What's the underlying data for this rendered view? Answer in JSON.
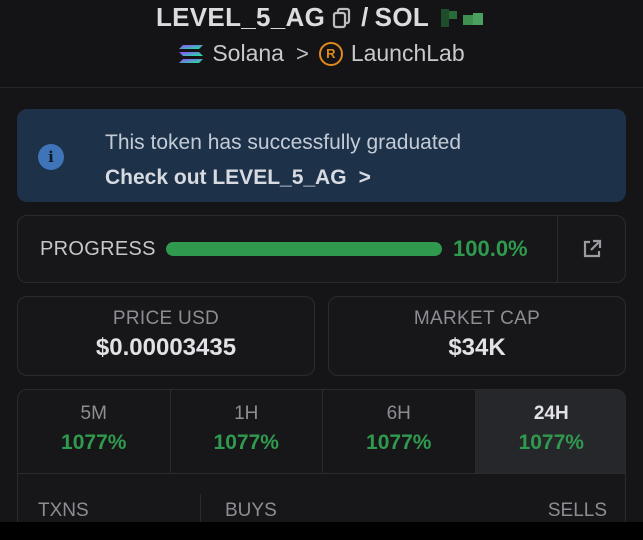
{
  "header": {
    "token": "LEVEL_5_AG",
    "separator": "/",
    "quote": "SOL",
    "chain": "Solana",
    "chevron": ">",
    "launchpad": "LaunchLab",
    "launchpad_icon_letter": "R"
  },
  "banner": {
    "message": "This token has successfully graduated",
    "cta": "Check out LEVEL_5_AG",
    "cta_arrow": ">",
    "icon_glyph": "i"
  },
  "progress": {
    "label": "PROGRESS",
    "value": "100.0%",
    "fraction": 1.0
  },
  "stats": {
    "price_label": "PRICE USD",
    "price_value": "$0.00003435",
    "mcap_label": "MARKET CAP",
    "mcap_value": "$34K"
  },
  "timeframes": [
    {
      "name": "5M",
      "change": "1077%"
    },
    {
      "name": "1H",
      "change": "1077%"
    },
    {
      "name": "6H",
      "change": "1077%"
    },
    {
      "name": "24H",
      "change": "1077%",
      "active": true
    }
  ],
  "transactions": {
    "txns_label": "TXNS",
    "buys_label": "BUYS",
    "sells_label": "SELLS"
  },
  "colors": {
    "background": "#151517",
    "positive": "#2f9a4e",
    "banner_bg": "#1d3149",
    "info_icon": "#3f74b8",
    "launchpad_icon": "#e08a1c"
  },
  "icons": {
    "copy": "copy-icon",
    "chain": "solana-icon",
    "launchpad": "raydium-icon",
    "info": "info-icon",
    "external": "external-link-icon"
  }
}
